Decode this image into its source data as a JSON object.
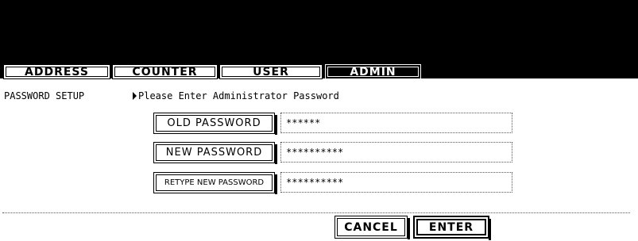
{
  "tabs": [
    {
      "label": "ADDRESS",
      "active": false
    },
    {
      "label": "COUNTER",
      "active": false
    },
    {
      "label": "USER",
      "active": false
    },
    {
      "label": "ADMIN",
      "active": true
    }
  ],
  "header": {
    "title": "PASSWORD SETUP",
    "message": "Please Enter Administrator Password"
  },
  "fields": [
    {
      "label": "OLD PASSWORD",
      "value": "******"
    },
    {
      "label": "NEW PASSWORD",
      "value": "**********"
    },
    {
      "label": "RETYPE NEW PASSWORD",
      "value": "**********"
    }
  ],
  "actions": {
    "cancel_label": "CANCEL",
    "enter_label": "ENTER"
  },
  "colors": {
    "background": "#ffffff",
    "foreground": "#000000"
  },
  "icons": {
    "message_marker": "triangle-right-icon"
  }
}
